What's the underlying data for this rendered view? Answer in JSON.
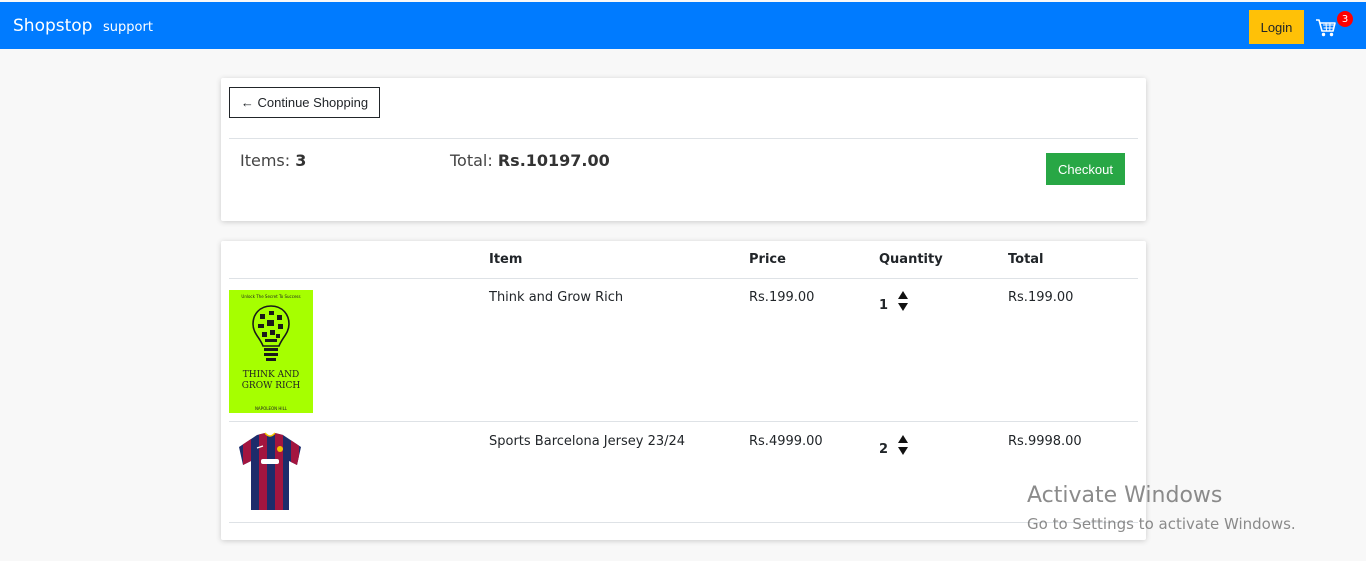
{
  "navbar": {
    "brand": "Shopstop",
    "support_link": "support",
    "login_label": "Login",
    "cart_count": "3",
    "cart_icon": "cart-icon",
    "color": "#007bff"
  },
  "summary": {
    "continue_label": "← Continue Shopping",
    "items_prefix": "Items: ",
    "items_count": "3",
    "total_prefix": "Total: ",
    "total_value": "Rs.10197.00",
    "checkout_label": "Checkout"
  },
  "table": {
    "headers": [
      "Item",
      "Price",
      "Quantity",
      "Total"
    ],
    "rows": [
      {
        "image": {
          "tagline": "Unlock The Secret To Success",
          "title": "THINK AND GROW RICH",
          "author": "NAPOLEON HILL"
        },
        "name": "Think and Grow Rich",
        "price": "Rs.199.00",
        "quantity": "1",
        "total": "Rs.199.00"
      },
      {
        "name": "Sports Barcelona Jersey 23/24",
        "price": "Rs.4999.00",
        "quantity": "2",
        "total": "Rs.9998.00"
      }
    ]
  },
  "watermark": {
    "line1": "Activate Windows",
    "line2": "Go to Settings to activate Windows."
  },
  "colors": {
    "login": "#ffc107",
    "checkout": "#28a745",
    "badge": "#ff0000",
    "book_cover": "#a6ff00"
  }
}
